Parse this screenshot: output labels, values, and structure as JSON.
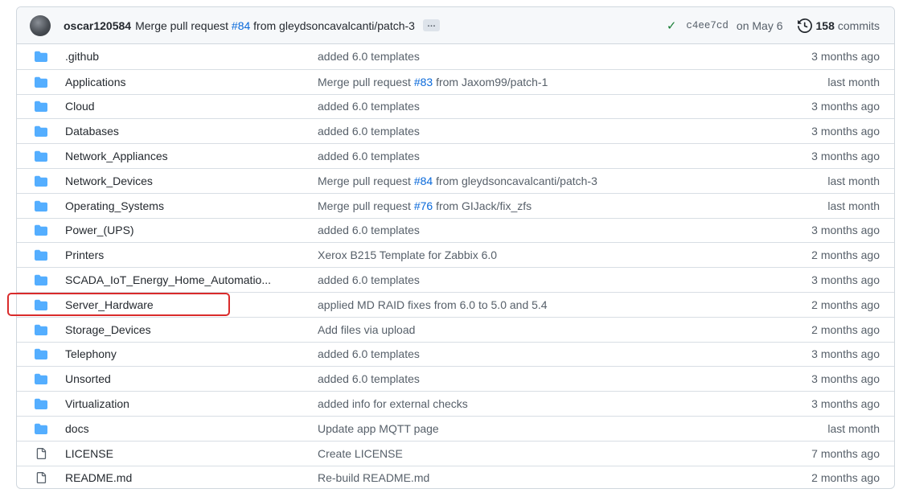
{
  "latest_commit": {
    "author": "oscar120584",
    "message_prefix": "Merge pull request",
    "pr_link": "#84",
    "message_suffix": "from gleydsoncavalcanti/patch-3",
    "ellipsis": "…",
    "sha": "c4ee7cd",
    "date": "on May 6",
    "commits_count": "158",
    "commits_label": "commits"
  },
  "files": [
    {
      "type": "folder",
      "name": ".github",
      "commit": {
        "text": "added 6.0 templates"
      },
      "age": "3 months ago"
    },
    {
      "type": "folder",
      "name": "Applications",
      "commit": {
        "prefix": "Merge pull request",
        "link": "#83",
        "suffix": "from Jaxom99/patch-1"
      },
      "age": "last month"
    },
    {
      "type": "folder",
      "name": "Cloud",
      "commit": {
        "text": "added 6.0 templates"
      },
      "age": "3 months ago"
    },
    {
      "type": "folder",
      "name": "Databases",
      "commit": {
        "text": "added 6.0 templates"
      },
      "age": "3 months ago"
    },
    {
      "type": "folder",
      "name": "Network_Appliances",
      "commit": {
        "text": "added 6.0 templates"
      },
      "age": "3 months ago"
    },
    {
      "type": "folder",
      "name": "Network_Devices",
      "commit": {
        "prefix": "Merge pull request",
        "link": "#84",
        "suffix": "from gleydsoncavalcanti/patch-3"
      },
      "age": "last month"
    },
    {
      "type": "folder",
      "name": "Operating_Systems",
      "commit": {
        "prefix": "Merge pull request",
        "link": "#76",
        "suffix": "from GIJack/fix_zfs"
      },
      "age": "last month"
    },
    {
      "type": "folder",
      "name": "Power_(UPS)",
      "commit": {
        "text": "added 6.0 templates"
      },
      "age": "3 months ago"
    },
    {
      "type": "folder",
      "name": "Printers",
      "commit": {
        "text": "Xerox B215 Template for Zabbix 6.0"
      },
      "age": "2 months ago"
    },
    {
      "type": "folder",
      "name": "SCADA_IoT_Energy_Home_Automatio...",
      "commit": {
        "text": "added 6.0 templates"
      },
      "age": "3 months ago"
    },
    {
      "type": "folder",
      "name": "Server_Hardware",
      "commit": {
        "text": "applied MD RAID fixes from 6.0 to 5.0 and 5.4"
      },
      "age": "2 months ago"
    },
    {
      "type": "folder",
      "name": "Storage_Devices",
      "commit": {
        "text": "Add files via upload"
      },
      "age": "2 months ago"
    },
    {
      "type": "folder",
      "name": "Telephony",
      "commit": {
        "text": "added 6.0 templates"
      },
      "age": "3 months ago"
    },
    {
      "type": "folder",
      "name": "Unsorted",
      "commit": {
        "text": "added 6.0 templates"
      },
      "age": "3 months ago"
    },
    {
      "type": "folder",
      "name": "Virtualization",
      "commit": {
        "text": "added info for external checks"
      },
      "age": "3 months ago"
    },
    {
      "type": "folder",
      "name": "docs",
      "commit": {
        "text": "Update app MQTT page"
      },
      "age": "last month"
    },
    {
      "type": "file",
      "name": "LICENSE",
      "commit": {
        "text": "Create LICENSE"
      },
      "age": "7 months ago"
    },
    {
      "type": "file",
      "name": "README.md",
      "commit": {
        "text": "Re-build README.md"
      },
      "age": "2 months ago"
    }
  ],
  "highlighted_item": "Server_Hardware",
  "colors": {
    "folder": "#54aeff",
    "link": "#0969da",
    "highlight": "#d92b2b",
    "check": "#1a7f37"
  }
}
